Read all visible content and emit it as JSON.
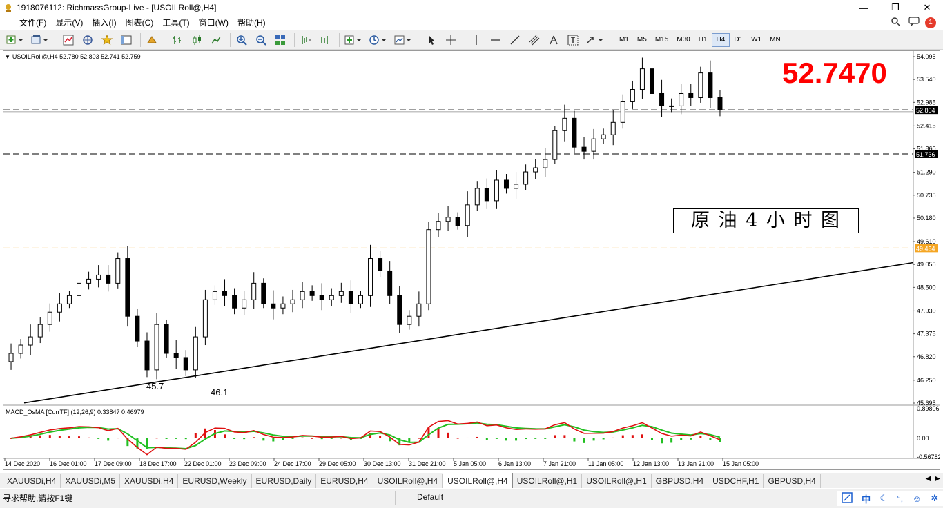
{
  "window": {
    "title": "1918076112: RichmassGroup-Live - [USOILRoll@,H4]",
    "minimize": "—",
    "restore": "❐",
    "close": "✕"
  },
  "menu": {
    "items": [
      "文件(F)",
      "显示(V)",
      "插入(I)",
      "图表(C)",
      "工具(T)",
      "窗口(W)",
      "帮助(H)"
    ],
    "notification_count": "1"
  },
  "toolbar": {
    "timeframes": [
      "M1",
      "M5",
      "M15",
      "M30",
      "H1",
      "H4",
      "D1",
      "W1",
      "MN"
    ],
    "active_timeframe": "H4"
  },
  "chart": {
    "header": "USOILRoll@,H4  52.780 52.803 52.741 52.759",
    "big_price": "52.7470",
    "big_price_color": "#ff0000",
    "annotation_text": "原 油 4 小 时 图",
    "low_label_1": "45.7",
    "low_label_2": "46.1",
    "hlines": [
      {
        "price": 52.804,
        "label": "52.804",
        "style": "dashed",
        "color": "#000000"
      },
      {
        "price": 51.736,
        "label": "51.736",
        "style": "dashed",
        "color": "#000000"
      },
      {
        "price": 49.454,
        "label": "49.454",
        "style": "dashed",
        "color": "#f5a623"
      }
    ],
    "y_ticks": [
      "54.095",
      "53.540",
      "52.985",
      "52.415",
      "51.860",
      "51.290",
      "50.735",
      "50.180",
      "49.610",
      "49.055",
      "48.500",
      "47.930",
      "47.375",
      "46.820",
      "46.250",
      "45.695"
    ],
    "x_ticks": [
      "14 Dec 2020",
      "16 Dec 01:00",
      "17 Dec 09:00",
      "18 Dec 17:00",
      "22 Dec 01:00",
      "23 Dec 09:00",
      "24 Dec 17:00",
      "29 Dec 05:00",
      "30 Dec 13:00",
      "31 Dec 21:00",
      "5 Jan 05:00",
      "6 Jan 13:00",
      "7 Jan 21:00",
      "11 Jan 05:00",
      "12 Jan 13:00",
      "13 Jan 21:00",
      "15 Jan 05:00"
    ],
    "bull_color": "#ffffff",
    "bear_color": "#000000"
  },
  "indicator": {
    "header": "MACD_OsMA [CurrTF] (12,26,9) 0.33847 0.46979",
    "y_ticks": [
      "0.89806",
      "0.00",
      "-0.56782"
    ],
    "hist_up_color": "#e01010",
    "hist_down_color": "#22c022",
    "macd_color": "#e01010",
    "signal_color": "#22c022"
  },
  "chart_data": {
    "type": "line",
    "title": "",
    "xlabel": "",
    "ylabel": "",
    "series": [
      {
        "values": [
          46.9,
          47.1,
          47.3,
          47.6,
          47.9,
          48.1,
          48.3,
          48.6,
          48.7,
          48.8,
          48.6,
          49.2,
          47.8,
          47.2,
          46.5,
          47.6,
          46.9,
          46.8,
          46.5,
          47.3,
          48.2,
          48.4,
          48.3,
          48.0,
          48.2,
          48.6,
          48.1,
          48.0,
          48.1,
          48.2,
          48.4,
          48.3,
          48.2,
          48.3,
          48.4,
          48.1,
          48.3,
          49.2,
          48.9,
          48.3,
          47.6,
          47.8,
          48.1,
          49.9,
          50.1,
          50.2,
          50.0,
          50.5,
          50.9,
          50.6,
          51.1,
          50.9,
          51.0,
          51.3,
          51.4,
          51.6,
          52.3,
          52.6,
          51.9,
          51.8,
          52.1,
          52.2,
          52.5,
          53.0,
          53.3,
          53.8,
          53.2,
          52.9,
          52.9,
          53.2,
          53.1,
          53.7,
          53.1,
          52.8
        ]
      }
    ],
    "ylim": [
      45.695,
      54.095
    ]
  }
}
